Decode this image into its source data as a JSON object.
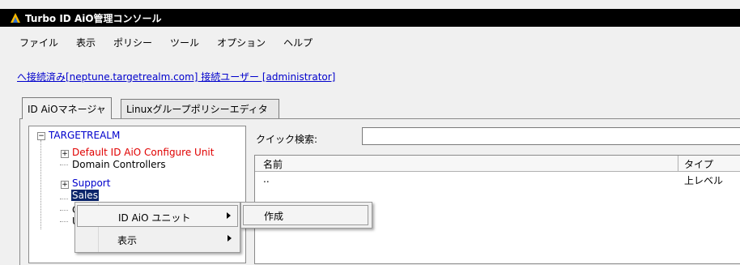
{
  "window": {
    "title": "Turbo ID AiO管理コンソール"
  },
  "menu": [
    "ファイル",
    "表示",
    "ポリシー",
    "ツール",
    "オプション",
    "ヘルプ"
  ],
  "connection": {
    "text": "へ接続済み[neptune.targetrealm.com] 接続ユーザー [administrator]"
  },
  "tabs": [
    {
      "label": "ID AiOマネージャ",
      "active": true
    },
    {
      "label": "Linuxグループポリシーエディタ",
      "active": false
    }
  ],
  "tree": {
    "root": "TARGETREALM",
    "nodes": [
      {
        "label": "Default ID AiO Configure Unit",
        "color": "red"
      },
      {
        "label": "Domain Controllers",
        "color": "black"
      },
      {
        "label": "Support",
        "color": "blue"
      },
      {
        "label": "Sales",
        "selected": true
      },
      {
        "label": "C"
      },
      {
        "label": "U"
      }
    ]
  },
  "search": {
    "label": "クイック検索:",
    "value": ""
  },
  "list": {
    "columns": [
      "名前",
      "タイプ"
    ],
    "rows": [
      {
        "name": "..",
        "type": "上レベル"
      }
    ]
  },
  "context_menu": {
    "items": [
      {
        "label": "ID AiO ユニット",
        "has_submenu": true
      },
      {
        "label": "表示",
        "has_submenu": true
      }
    ]
  },
  "submenu": {
    "items": [
      "作成"
    ]
  }
}
